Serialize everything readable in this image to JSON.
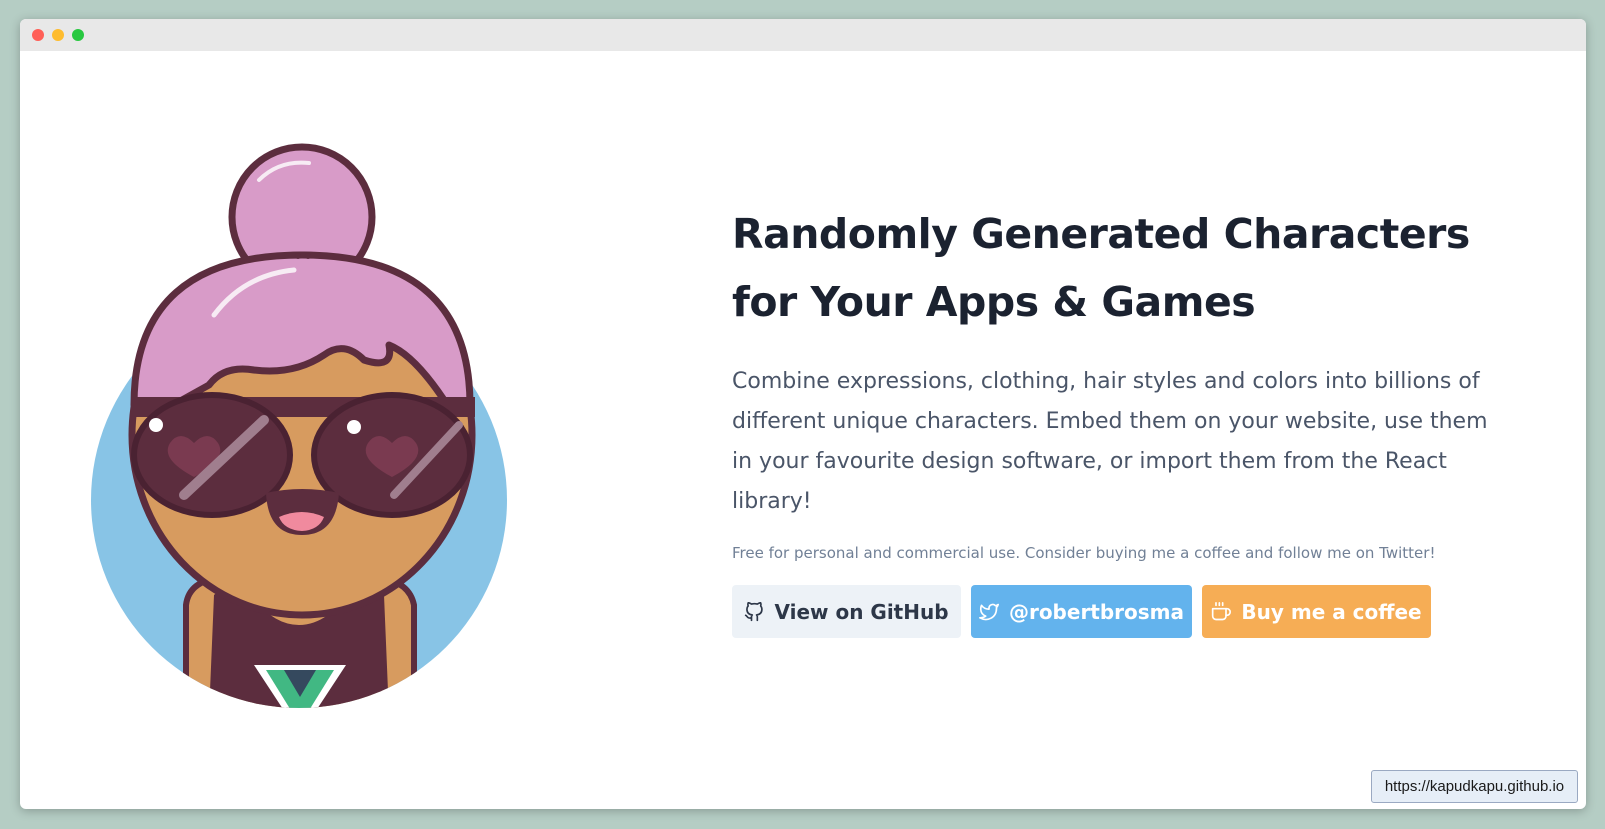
{
  "window": {
    "controls": [
      "close-dot",
      "minimize-dot",
      "maximize-dot"
    ]
  },
  "hero": {
    "title": "Randomly Generated Characters for Your Apps & Games",
    "lead": "Combine expressions, clothing, hair styles and colors into billions of different unique characters. Embed them on your website, use them in your favourite design software, or import them from the React library!",
    "note": "Free for personal and commercial use. Consider buying me a coffee and follow me on Twitter!"
  },
  "buttons": {
    "github": {
      "label": "View on GitHub",
      "icon": "github-icon"
    },
    "twitter": {
      "label": "@robertbrosma",
      "icon": "twitter-icon"
    },
    "coffee": {
      "label": "Buy me a coffee",
      "icon": "coffee-icon"
    }
  },
  "status": {
    "url": "https://kapudkapu.github.io"
  },
  "colors": {
    "background": "#b5cdc4",
    "github_btn": "#edf2f7",
    "twitter_btn": "#63b3ed",
    "coffee_btn": "#f6ad55",
    "title": "#1b2230",
    "avatar_circle": "#88c4e6",
    "hair": "#d89bc8"
  }
}
